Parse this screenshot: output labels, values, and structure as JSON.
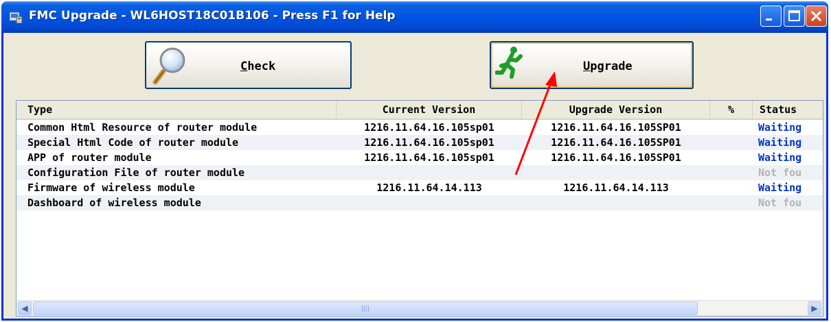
{
  "window": {
    "title": "FMC Upgrade - WL6HOST18C01B106 - Press F1 for Help"
  },
  "toolbar": {
    "check_label_first": "C",
    "check_label_rest": "heck",
    "upgrade_label_first": "U",
    "upgrade_label_rest": "pgrade"
  },
  "table": {
    "headers": {
      "type": "Type",
      "current": "Current Version",
      "upgrade": "Upgrade Version",
      "percent": "%",
      "status": "Status"
    },
    "rows": [
      {
        "type": "Common Html Resource of router module",
        "current": "1216.11.64.16.105sp01",
        "upgrade": "1216.11.64.16.105SP01",
        "percent": "",
        "status": "Waiting"
      },
      {
        "type": "Special Html Code of router module",
        "current": "1216.11.64.16.105sp01",
        "upgrade": "1216.11.64.16.105SP01",
        "percent": "",
        "status": "Waiting"
      },
      {
        "type": "APP of router module",
        "current": "1216.11.64.16.105sp01",
        "upgrade": "1216.11.64.16.105SP01",
        "percent": "",
        "status": "Waiting"
      },
      {
        "type": "Configuration File of router module",
        "current": "",
        "upgrade": "",
        "percent": "",
        "status": "Not fou"
      },
      {
        "type": "Firmware of wireless module",
        "current": "1216.11.64.14.113",
        "upgrade": "1216.11.64.14.113",
        "percent": "",
        "status": "Waiting"
      },
      {
        "type": "Dashboard of wireless module",
        "current": "",
        "upgrade": "",
        "percent": "",
        "status": "Not fou"
      }
    ]
  },
  "colors": {
    "status_waiting": "#0033cc",
    "status_not_found": "#b3b3b3",
    "annotation_arrow": "#ff0000"
  },
  "icons": {
    "check_button": "magnifier-icon",
    "upgrade_button": "running-man-icon",
    "app": "app-icon"
  }
}
